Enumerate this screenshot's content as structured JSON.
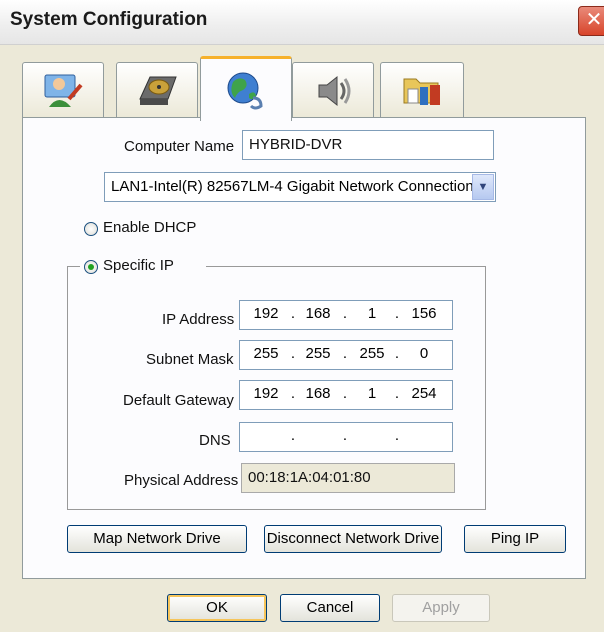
{
  "window": {
    "title": "System Configuration"
  },
  "tabs": [
    {
      "icon": "user-setup-icon"
    },
    {
      "icon": "hard-disk-icon"
    },
    {
      "icon": "network-globe-icon",
      "active": true
    },
    {
      "icon": "speaker-icon"
    },
    {
      "icon": "file-archive-icon"
    }
  ],
  "network": {
    "computer_name_label": "Computer Name",
    "computer_name_value": "HYBRID-DVR",
    "adapter_selected": "LAN1-Intel(R) 82567LM-4 Gigabit Network Connection",
    "enable_dhcp_label": "Enable DHCP",
    "specific_ip_label": "Specific IP",
    "ip_address_label": "IP Address",
    "ip_address": [
      "192",
      "168",
      "1",
      "156"
    ],
    "subnet_mask_label": "Subnet Mask",
    "subnet_mask": [
      "255",
      "255",
      "255",
      "0"
    ],
    "gateway_label": "Default Gateway",
    "gateway": [
      "192",
      "168",
      "1",
      "254"
    ],
    "dns_label": "DNS",
    "dns": [
      "",
      "",
      "",
      ""
    ],
    "physical_address_label": "Physical Address",
    "physical_address": "00:18:1A:04:01:80"
  },
  "actions": {
    "map_drive": "Map Network Drive",
    "disconnect_drive": "Disconnect Network Drive",
    "ping_ip": "Ping IP"
  },
  "footer": {
    "ok": "OK",
    "cancel": "Cancel",
    "apply": "Apply"
  },
  "colors": {
    "accent_tab": "#f6b12b",
    "close_red": "#d8442a",
    "dhcp_green": "#21a121"
  }
}
